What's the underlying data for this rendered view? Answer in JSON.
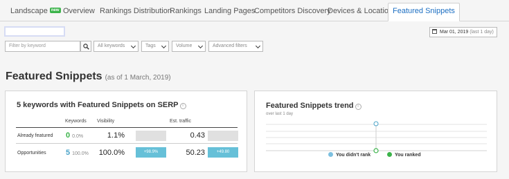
{
  "tabs": [
    {
      "label": "Landscape",
      "badge": "new"
    },
    {
      "label": "Overview"
    },
    {
      "label": "Rankings Distribution"
    },
    {
      "label": "Rankings"
    },
    {
      "label": "Landing Pages"
    },
    {
      "label": "Competitors Discovery"
    },
    {
      "label": "Devices & Locations"
    },
    {
      "label": "Featured Snippets",
      "active": true
    }
  ],
  "date": {
    "value": "Mar 01, 2019",
    "range": "(last 1 day)"
  },
  "filters": {
    "search_placeholder": "Filter by keyword",
    "keywords": "All keywords",
    "tags": "Tags",
    "volume": "Volume",
    "advanced": "Advanced filters"
  },
  "heading": {
    "title": "Featured Snippets",
    "subtitle": "(as of 1 March, 2019)"
  },
  "summary": {
    "title": "5 keywords with Featured Snippets on SERP",
    "columns": {
      "keywords": "Keywords",
      "visibility": "Visibility",
      "traffic": "Est. traffic"
    },
    "rows": [
      {
        "label": "Already featured",
        "keywords": "0",
        "keywords_pct": "0.0%",
        "visibility": "1.1%",
        "visibility_delta": "",
        "traffic": "0.43",
        "traffic_delta": "",
        "color": "#3bb34a"
      },
      {
        "label": "Opportunities",
        "keywords": "5",
        "keywords_pct": "100.0%",
        "visibility": "100.0%",
        "visibility_delta": "+98.9%",
        "traffic": "50.23",
        "traffic_delta": "+49.80",
        "color": "#4aa3c8"
      }
    ]
  },
  "trend": {
    "title": "Featured Snippets trend",
    "subtitle": "over last 1 day",
    "legend": [
      {
        "label": "You didn't rank",
        "color": "#7cc0e0"
      },
      {
        "label": "You ranked",
        "color": "#3bb34a"
      }
    ]
  }
}
